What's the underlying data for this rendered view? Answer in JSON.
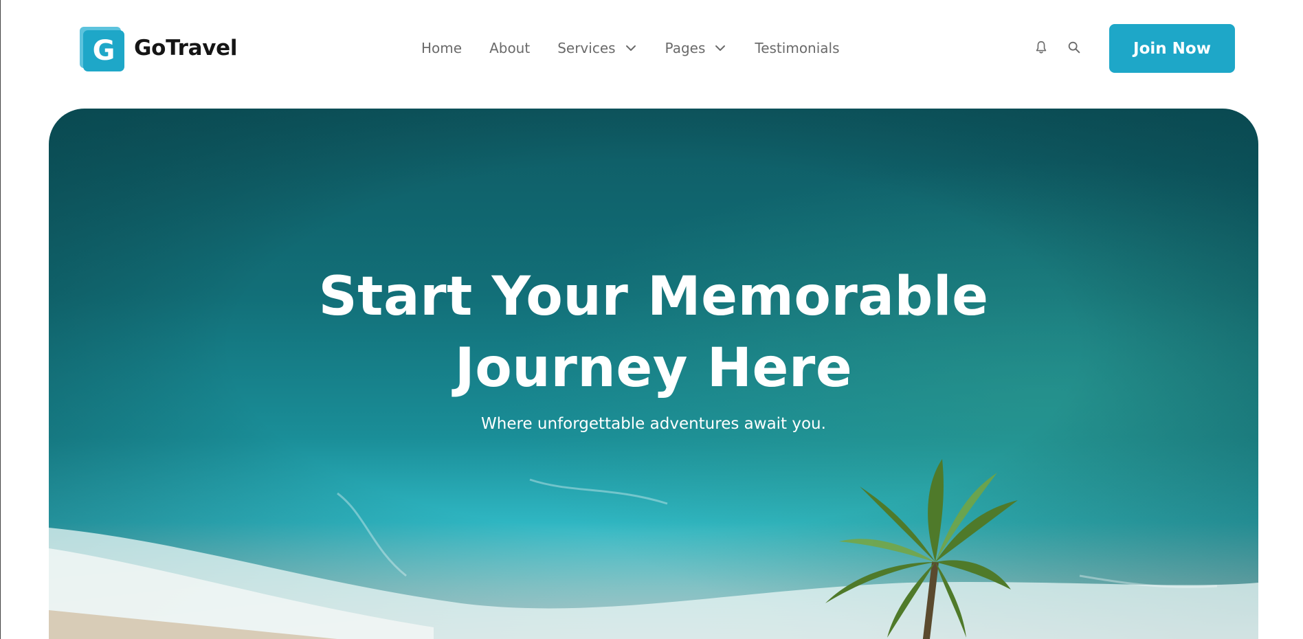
{
  "brand": {
    "logo_letter": "G",
    "name": "GoTravel"
  },
  "nav": {
    "home": "Home",
    "about": "About",
    "services": "Services",
    "pages": "Pages",
    "testimonials": "Testimonials"
  },
  "actions": {
    "notification_icon": "bell-icon",
    "search_icon": "search-icon",
    "join_label": "Join Now"
  },
  "hero": {
    "title_line1": "Start Your Memorable",
    "title_line2": "Journey Here",
    "subtitle": "Where unforgettable adventures await you."
  },
  "colors": {
    "accent": "#1ea7c8",
    "nav_text": "#6a6a6a",
    "brand_text": "#151515",
    "sea_deep": "#0f5f66",
    "sea_shallow": "#37c1c9"
  }
}
